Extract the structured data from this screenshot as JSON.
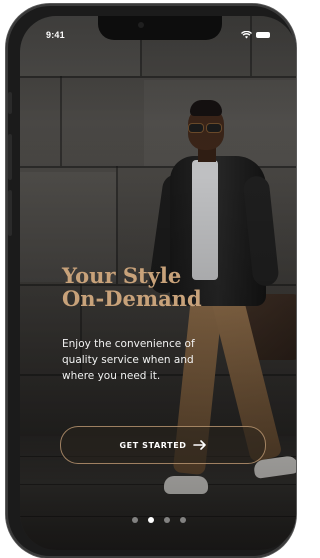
{
  "status_bar": {
    "time": "9:41",
    "icons": [
      "wifi-icon",
      "battery-icon"
    ]
  },
  "onboarding": {
    "title_line1": "Your Style",
    "title_line2": "On-Demand",
    "subtitle": "Enjoy the convenience of quality service when and where you need it.",
    "cta_label": "GET STARTED",
    "cta_icon": "arrow-right-icon",
    "page_indicator": {
      "count": 4,
      "active_index": 1
    }
  },
  "colors": {
    "accent": "#c8a27a",
    "text_primary": "#ffffff"
  }
}
